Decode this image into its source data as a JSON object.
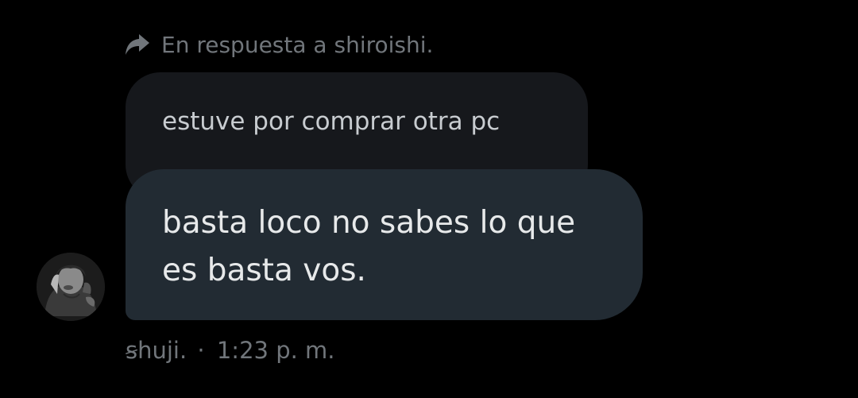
{
  "reply_header": {
    "icon": "reply-arrow-icon",
    "text": "En respuesta a shiroishi."
  },
  "quoted_message": {
    "text": "estuve por comprar otra pc"
  },
  "message": {
    "text": "basta loco no sabes lo que es basta vos."
  },
  "sender": {
    "avatar_icon": "avatar-image",
    "name": "ꞩhuji.",
    "separator": "·",
    "time": "1:23 p. m."
  },
  "colors": {
    "background": "#000000",
    "quoted_bubble": "#16181c",
    "message_bubble": "#222b33",
    "muted_text": "#71767b",
    "message_text": "#e7e9ea"
  }
}
